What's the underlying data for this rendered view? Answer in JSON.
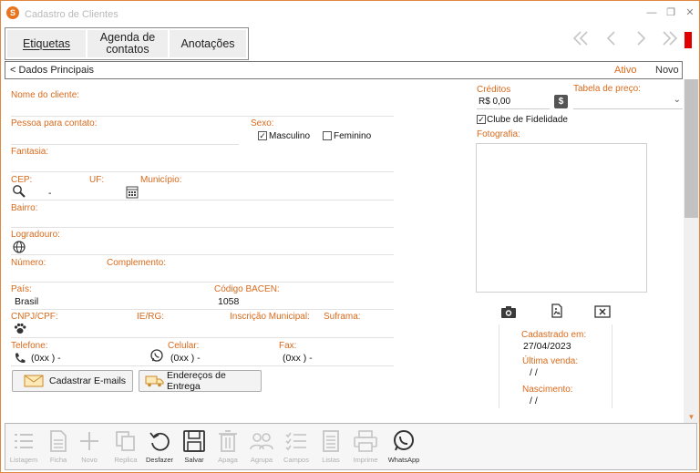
{
  "window": {
    "title": "Cadastro de Clientes",
    "app_icon": "S"
  },
  "window_buttons": [
    "—",
    "❐",
    "✕"
  ],
  "tabs": [
    {
      "label": "Etiquetas"
    },
    {
      "label_line1": "Agenda de",
      "label_line2": "contatos"
    },
    {
      "label": "Anotações"
    }
  ],
  "nav": {
    "first": "《",
    "prev": "〈",
    "next": "〉",
    "last": "》"
  },
  "section": {
    "label": "< Dados Principais",
    "status": "Ativo",
    "mode": "Novo"
  },
  "fields": {
    "nome": "Nome do cliente:",
    "contato": "Pessoa para contato:",
    "sexo": "Sexo:",
    "masculino": "Masculino",
    "feminino": "Feminino",
    "fantasia": "Fantasia:",
    "cep": "CEP:",
    "cep_value": "-",
    "uf": "UF:",
    "municipio": "Município:",
    "bairro": "Bairro:",
    "logradouro": "Logradouro:",
    "numero": "Número:",
    "complemento": "Complemento:",
    "pais": "País:",
    "pais_value": "Brasil",
    "bacen": "Código BACEN:",
    "bacen_value": "1058",
    "cnpj": "CNPJ/CPF:",
    "ie": "IE/RG:",
    "inscricao": "Inscrição Municipal:",
    "suframa": "Suframa:",
    "telefone": "Telefone:",
    "telefone_value": "(0xx  )    -",
    "celular": "Celular:",
    "celular_value": "(0xx  )    -",
    "fax": "Fax:",
    "fax_value": "(0xx  )    -"
  },
  "buttons": {
    "emails": "Cadastrar E-mails",
    "enderecos": "Endereços de Entrega"
  },
  "right": {
    "creditos": "Créditos",
    "creditos_value": "R$ 0,00",
    "creditos_btn": "$",
    "tabela": "Tabela de preço:",
    "clube": "Clube de Fidelidade",
    "fotografia": "Fotografia:",
    "cadastrado": "Cadastrado em:",
    "cadastrado_value": "27/04/2023",
    "ultima_venda": "Última venda:",
    "ultima_venda_value": "/  /",
    "nascimento": "Nascimento:",
    "nascimento_value": "/  /"
  },
  "toolbar": [
    {
      "label": "Listagem",
      "icon": "list-icon",
      "enabled": false
    },
    {
      "label": "Ficha",
      "icon": "file-icon",
      "enabled": false
    },
    {
      "label": "Novo",
      "icon": "plus-icon",
      "enabled": false
    },
    {
      "label": "Replica",
      "icon": "copy-icon",
      "enabled": false
    },
    {
      "label": "Desfazer",
      "icon": "undo-icon",
      "enabled": true
    },
    {
      "label": "Salvar",
      "icon": "save-icon",
      "enabled": true
    },
    {
      "label": "Apaga",
      "icon": "trash-icon",
      "enabled": false
    },
    {
      "label": "Agrupa",
      "icon": "group-icon",
      "enabled": false
    },
    {
      "label": "Campos",
      "icon": "checklist-icon",
      "enabled": false
    },
    {
      "label": "Listas",
      "icon": "doc-list-icon",
      "enabled": false
    },
    {
      "label": "Imprime",
      "icon": "printer-icon",
      "enabled": false
    },
    {
      "label": "WhatsApp",
      "icon": "whatsapp-icon",
      "enabled": true
    }
  ],
  "colors": {
    "accent": "#e0873f",
    "label": "#d96a1c",
    "status_red": "#e00000"
  }
}
